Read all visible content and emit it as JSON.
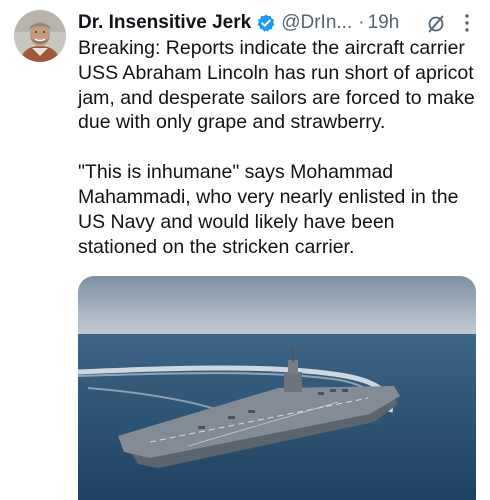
{
  "author": {
    "name": "Dr. Insensitive Jerk",
    "handle": "@DrIn...",
    "separator": "·",
    "time": "19h",
    "verified": true
  },
  "tweet": {
    "paragraphs": [
      "Breaking: Reports indicate the aircraft carrier USS Abraham Lincoln has run short of apricot jam, and desperate sailors are forced to make due with only grape and strawberry.",
      "\"This is inhumane\" says Mohammad Mahammadi, who very nearly enlisted in the US Navy and would likely have been stationed on the stricken carrier."
    ]
  },
  "icons": {
    "verified": "verified-badge-icon",
    "grok": "grok-icon",
    "more": "more-options-icon"
  },
  "colors": {
    "text": "#0f1419",
    "secondary": "#536471",
    "verified": "#1d9bf0",
    "sea": "#2a4f6e"
  }
}
